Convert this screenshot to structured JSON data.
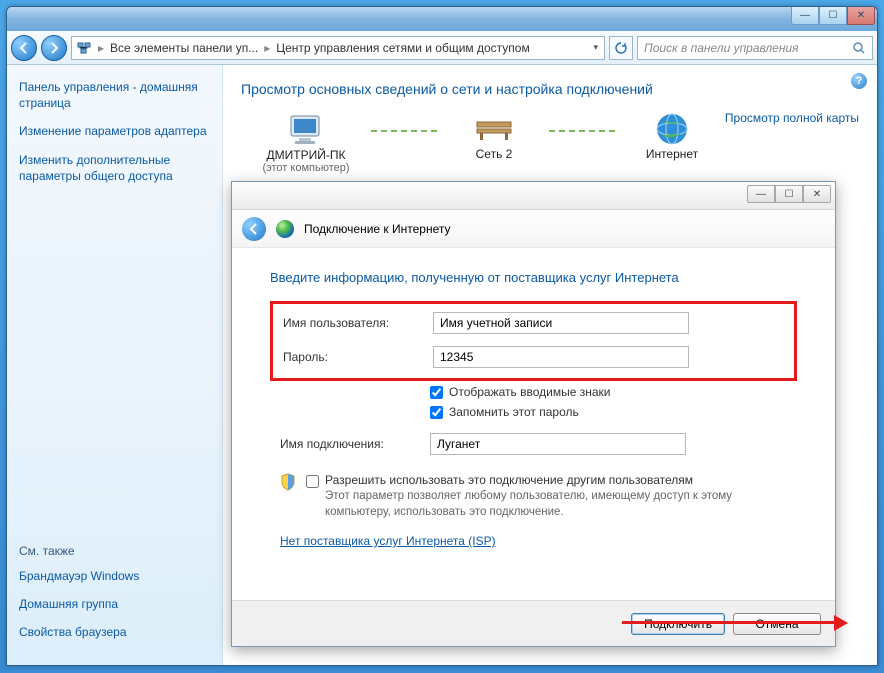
{
  "titlebar": {
    "min": "—",
    "max": "☐",
    "close": "✕"
  },
  "nav": {
    "crumb_icon_label": "",
    "crumb1": "Все элементы панели уп...",
    "crumb2": "Центр управления сетями и общим доступом",
    "search_placeholder": "Поиск в панели управления"
  },
  "sidebar": {
    "home": "Панель управления - домашняя страница",
    "link1": "Изменение параметров адаптера",
    "link2": "Изменить дополнительные параметры общего доступа",
    "seealso": "См. также",
    "sa1": "Брандмауэр Windows",
    "sa2": "Домашняя группа",
    "sa3": "Свойства браузера"
  },
  "main": {
    "heading": "Просмотр основных сведений о сети и настройка подключений",
    "pc": "ДМИТРИЙ-ПК",
    "pc_sub": "(этот компьютер)",
    "net": "Сеть 2",
    "inet": "Интернет",
    "maplink": "Просмотр полной карты"
  },
  "dialog": {
    "title": "Подключение к Интернету",
    "heading": "Введите информацию, полученную от поставщика услуг Интернета",
    "user_label": "Имя пользователя:",
    "user_value": "Имя учетной записи",
    "pass_label": "Пароль:",
    "pass_value": "12345",
    "chk_show": "Отображать вводимые знаки",
    "chk_remember": "Запомнить этот пароль",
    "conn_label": "Имя подключения:",
    "conn_value": "Луганет",
    "allow_label": "Разрешить использовать это подключение другим пользователям",
    "allow_hint": "Этот параметр позволяет любому пользователю, имеющему доступ к этому компьютеру, использовать это подключение.",
    "isp_link": "Нет поставщика услуг Интернета (ISP)",
    "btn_connect": "Подключить",
    "btn_cancel": "Отмена"
  }
}
